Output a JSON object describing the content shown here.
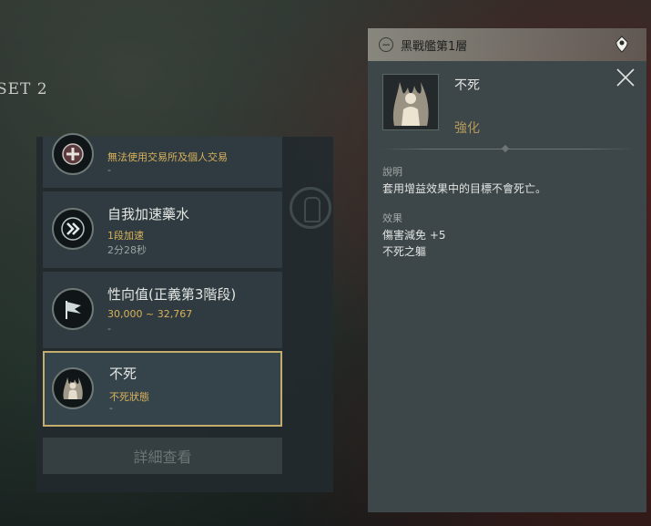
{
  "preset_label": "SET 2",
  "buffs": [
    {
      "title": "",
      "sub": "無法使用交易所及個人交易",
      "meta": "-"
    },
    {
      "title": "自我加速藥水",
      "sub": "1段加速",
      "meta": "2分28秒"
    },
    {
      "title": "性向值(正義第3階段)",
      "sub": "30,000 ~ 32,767",
      "meta": "-"
    },
    {
      "title": "不死",
      "sub": "不死狀態",
      "meta": "-"
    }
  ],
  "detail_button_label": "詳細查看",
  "location": {
    "name": "黑戰艦第1層"
  },
  "detail": {
    "name": "不死",
    "type": "強化",
    "desc_heading": "說明",
    "desc_text": "套用增益效果中的目標不會死亡。",
    "effect_heading": "效果",
    "effect_line1": "傷害減免 +5",
    "effect_line2": "不死之軀"
  },
  "icons": [
    "shield-cross-icon",
    "double-chevron-icon",
    "justice-flag-icon",
    "undead-figure-icon",
    "close-icon",
    "map-pin-icon",
    "collapse-icon"
  ],
  "colors": {
    "accent_gold": "#d8b25a",
    "selected_border": "#c2ad6c",
    "type_text": "#b39a5c"
  }
}
